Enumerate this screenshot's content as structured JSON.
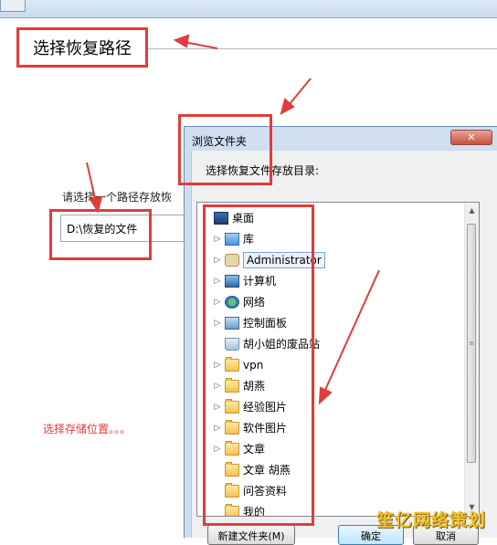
{
  "page": {
    "section_title": "选择恢复路径",
    "prompt_label": "请选择一个路径存放恢",
    "path_value": "D:\\恢复的文件",
    "hint_text": "选择存储位置。。。"
  },
  "dialog": {
    "title": "浏览文件夹",
    "close_glyph": "✕",
    "label": "选择恢复文件存放目录:",
    "tree": [
      {
        "label": "桌面",
        "icon": "desktop-icon",
        "expander": "",
        "indent": 0
      },
      {
        "label": "库",
        "icon": "library-folder-icon",
        "expander": "▷",
        "indent": 1
      },
      {
        "label": "Administrator",
        "icon": "user-folder-icon",
        "expander": "▷",
        "indent": 1,
        "selected": true
      },
      {
        "label": "计算机",
        "icon": "computer-icon",
        "expander": "▷",
        "indent": 1
      },
      {
        "label": "网络",
        "icon": "network-icon",
        "expander": "▷",
        "indent": 1
      },
      {
        "label": "控制面板",
        "icon": "control-panel-icon",
        "expander": "▷",
        "indent": 1
      },
      {
        "label": "胡小姐的废品站",
        "icon": "recycle-bin-icon",
        "expander": "",
        "indent": 1
      },
      {
        "label": "vpn",
        "icon": "folder-icon",
        "expander": "▷",
        "indent": 1
      },
      {
        "label": "胡燕",
        "icon": "folder-icon",
        "expander": "▷",
        "indent": 1
      },
      {
        "label": "经验图片",
        "icon": "folder-icon",
        "expander": "▷",
        "indent": 1
      },
      {
        "label": "软件图片",
        "icon": "folder-icon",
        "expander": "▷",
        "indent": 1
      },
      {
        "label": "文章",
        "icon": "folder-icon",
        "expander": "▷",
        "indent": 1
      },
      {
        "label": "文章  胡燕",
        "icon": "folder-icon",
        "expander": "",
        "indent": 1
      },
      {
        "label": "问答资料",
        "icon": "folder-icon",
        "expander": "",
        "indent": 1
      },
      {
        "label": "我的",
        "icon": "folder-icon",
        "expander": "",
        "indent": 1
      }
    ],
    "scroll_up": "▲",
    "scroll_down": "▼",
    "scroll_grip": "≡",
    "buttons": {
      "new_folder": "新建文件夹(M)",
      "ok": "确定",
      "cancel": "取消"
    }
  },
  "watermark": "笙亿网络策划",
  "colors": {
    "annotation_red": "#e03c3c",
    "dialog_frame": "#cfdff0",
    "watermark": "#f2c12e"
  }
}
